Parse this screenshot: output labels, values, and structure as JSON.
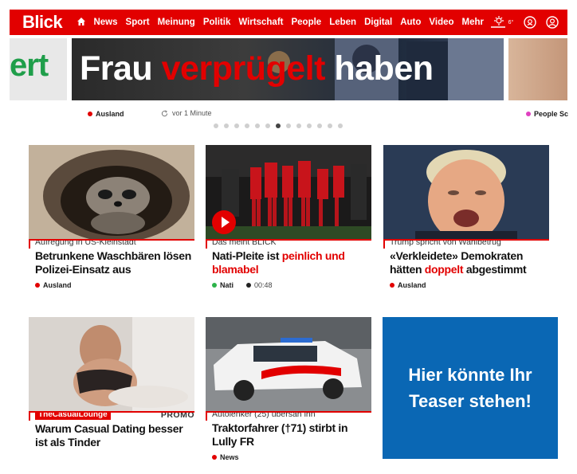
{
  "header": {
    "logo": "Blick",
    "nav": [
      "News",
      "Sport",
      "Meinung",
      "Politik",
      "Wirtschaft",
      "People",
      "Leben",
      "Digital",
      "Auto",
      "Video",
      "Mehr"
    ],
    "weather_temp": "6°"
  },
  "hero": {
    "left_text": "ert",
    "headline_white_1": "Frau ",
    "headline_red": "verprügelt",
    "headline_white_2": " haben",
    "category_left": "Ausland",
    "time_text": "vor 1 Minute",
    "category_right": "People Sc",
    "carousel_total": 13,
    "carousel_active": 6
  },
  "cards": [
    {
      "kicker": "Aufregung in US-Kleinstadt",
      "title": "Betrunkene Waschbären lösen Polizei-Einsatz aus",
      "category": "Ausland",
      "category_color": "#e20000"
    },
    {
      "kicker": "Das meint BLICK",
      "title_black": "Nati-Pleite ist ",
      "title_red": "peinlich und blamabel",
      "category": "Nati",
      "category_color": "#2db34a",
      "duration": "00:48"
    },
    {
      "kicker": "Trump spricht von Wahlbetrug",
      "title_black_1": "«Verkleidete» Demokraten hätten ",
      "title_red": "doppelt",
      "title_black_2": " abgestimmt",
      "category": "Ausland",
      "category_color": "#e20000"
    },
    {
      "promo_label": "TheCasualLounge",
      "promo_tag": "PROMO",
      "title": "Warum Casual Dating besser ist als Tinder"
    },
    {
      "kicker": "Autolenker (25) übersah ihn",
      "title": "Traktorfahrer (†71) stirbt in Lully FR",
      "category": "News",
      "category_color": "#e20000"
    }
  ],
  "teaser": {
    "text": "Hier könnte Ihr Teaser stehen!"
  },
  "colors": {
    "brand_red": "#e20000",
    "teaser_blue": "#0a67b4",
    "people_pink": "#e040c0"
  }
}
